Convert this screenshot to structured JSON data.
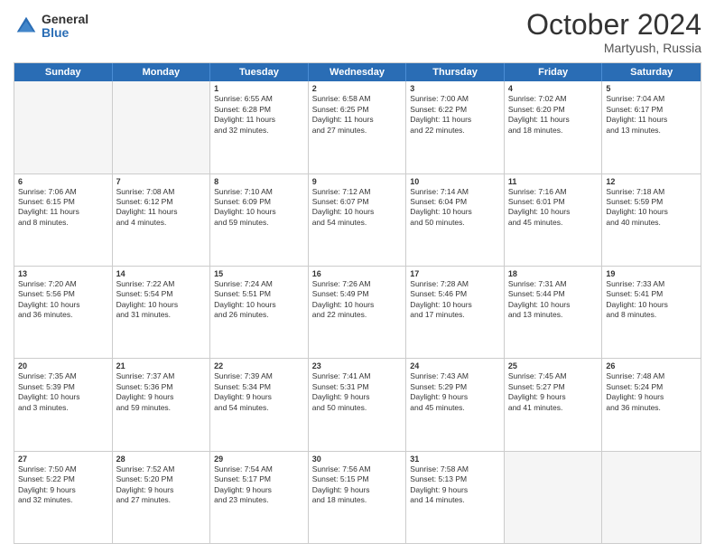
{
  "logo": {
    "general": "General",
    "blue": "Blue"
  },
  "title": "October 2024",
  "location": "Martyush, Russia",
  "header_days": [
    "Sunday",
    "Monday",
    "Tuesday",
    "Wednesday",
    "Thursday",
    "Friday",
    "Saturday"
  ],
  "weeks": [
    {
      "cells": [
        {
          "day": "",
          "lines": [],
          "empty": true
        },
        {
          "day": "",
          "lines": [],
          "empty": true
        },
        {
          "day": "1",
          "lines": [
            "Sunrise: 6:55 AM",
            "Sunset: 6:28 PM",
            "Daylight: 11 hours",
            "and 32 minutes."
          ],
          "empty": false
        },
        {
          "day": "2",
          "lines": [
            "Sunrise: 6:58 AM",
            "Sunset: 6:25 PM",
            "Daylight: 11 hours",
            "and 27 minutes."
          ],
          "empty": false
        },
        {
          "day": "3",
          "lines": [
            "Sunrise: 7:00 AM",
            "Sunset: 6:22 PM",
            "Daylight: 11 hours",
            "and 22 minutes."
          ],
          "empty": false
        },
        {
          "day": "4",
          "lines": [
            "Sunrise: 7:02 AM",
            "Sunset: 6:20 PM",
            "Daylight: 11 hours",
            "and 18 minutes."
          ],
          "empty": false
        },
        {
          "day": "5",
          "lines": [
            "Sunrise: 7:04 AM",
            "Sunset: 6:17 PM",
            "Daylight: 11 hours",
            "and 13 minutes."
          ],
          "empty": false
        }
      ]
    },
    {
      "cells": [
        {
          "day": "6",
          "lines": [
            "Sunrise: 7:06 AM",
            "Sunset: 6:15 PM",
            "Daylight: 11 hours",
            "and 8 minutes."
          ],
          "empty": false
        },
        {
          "day": "7",
          "lines": [
            "Sunrise: 7:08 AM",
            "Sunset: 6:12 PM",
            "Daylight: 11 hours",
            "and 4 minutes."
          ],
          "empty": false
        },
        {
          "day": "8",
          "lines": [
            "Sunrise: 7:10 AM",
            "Sunset: 6:09 PM",
            "Daylight: 10 hours",
            "and 59 minutes."
          ],
          "empty": false
        },
        {
          "day": "9",
          "lines": [
            "Sunrise: 7:12 AM",
            "Sunset: 6:07 PM",
            "Daylight: 10 hours",
            "and 54 minutes."
          ],
          "empty": false
        },
        {
          "day": "10",
          "lines": [
            "Sunrise: 7:14 AM",
            "Sunset: 6:04 PM",
            "Daylight: 10 hours",
            "and 50 minutes."
          ],
          "empty": false
        },
        {
          "day": "11",
          "lines": [
            "Sunrise: 7:16 AM",
            "Sunset: 6:01 PM",
            "Daylight: 10 hours",
            "and 45 minutes."
          ],
          "empty": false
        },
        {
          "day": "12",
          "lines": [
            "Sunrise: 7:18 AM",
            "Sunset: 5:59 PM",
            "Daylight: 10 hours",
            "and 40 minutes."
          ],
          "empty": false
        }
      ]
    },
    {
      "cells": [
        {
          "day": "13",
          "lines": [
            "Sunrise: 7:20 AM",
            "Sunset: 5:56 PM",
            "Daylight: 10 hours",
            "and 36 minutes."
          ],
          "empty": false
        },
        {
          "day": "14",
          "lines": [
            "Sunrise: 7:22 AM",
            "Sunset: 5:54 PM",
            "Daylight: 10 hours",
            "and 31 minutes."
          ],
          "empty": false
        },
        {
          "day": "15",
          "lines": [
            "Sunrise: 7:24 AM",
            "Sunset: 5:51 PM",
            "Daylight: 10 hours",
            "and 26 minutes."
          ],
          "empty": false
        },
        {
          "day": "16",
          "lines": [
            "Sunrise: 7:26 AM",
            "Sunset: 5:49 PM",
            "Daylight: 10 hours",
            "and 22 minutes."
          ],
          "empty": false
        },
        {
          "day": "17",
          "lines": [
            "Sunrise: 7:28 AM",
            "Sunset: 5:46 PM",
            "Daylight: 10 hours",
            "and 17 minutes."
          ],
          "empty": false
        },
        {
          "day": "18",
          "lines": [
            "Sunrise: 7:31 AM",
            "Sunset: 5:44 PM",
            "Daylight: 10 hours",
            "and 13 minutes."
          ],
          "empty": false
        },
        {
          "day": "19",
          "lines": [
            "Sunrise: 7:33 AM",
            "Sunset: 5:41 PM",
            "Daylight: 10 hours",
            "and 8 minutes."
          ],
          "empty": false
        }
      ]
    },
    {
      "cells": [
        {
          "day": "20",
          "lines": [
            "Sunrise: 7:35 AM",
            "Sunset: 5:39 PM",
            "Daylight: 10 hours",
            "and 3 minutes."
          ],
          "empty": false
        },
        {
          "day": "21",
          "lines": [
            "Sunrise: 7:37 AM",
            "Sunset: 5:36 PM",
            "Daylight: 9 hours",
            "and 59 minutes."
          ],
          "empty": false
        },
        {
          "day": "22",
          "lines": [
            "Sunrise: 7:39 AM",
            "Sunset: 5:34 PM",
            "Daylight: 9 hours",
            "and 54 minutes."
          ],
          "empty": false
        },
        {
          "day": "23",
          "lines": [
            "Sunrise: 7:41 AM",
            "Sunset: 5:31 PM",
            "Daylight: 9 hours",
            "and 50 minutes."
          ],
          "empty": false
        },
        {
          "day": "24",
          "lines": [
            "Sunrise: 7:43 AM",
            "Sunset: 5:29 PM",
            "Daylight: 9 hours",
            "and 45 minutes."
          ],
          "empty": false
        },
        {
          "day": "25",
          "lines": [
            "Sunrise: 7:45 AM",
            "Sunset: 5:27 PM",
            "Daylight: 9 hours",
            "and 41 minutes."
          ],
          "empty": false
        },
        {
          "day": "26",
          "lines": [
            "Sunrise: 7:48 AM",
            "Sunset: 5:24 PM",
            "Daylight: 9 hours",
            "and 36 minutes."
          ],
          "empty": false
        }
      ]
    },
    {
      "cells": [
        {
          "day": "27",
          "lines": [
            "Sunrise: 7:50 AM",
            "Sunset: 5:22 PM",
            "Daylight: 9 hours",
            "and 32 minutes."
          ],
          "empty": false
        },
        {
          "day": "28",
          "lines": [
            "Sunrise: 7:52 AM",
            "Sunset: 5:20 PM",
            "Daylight: 9 hours",
            "and 27 minutes."
          ],
          "empty": false
        },
        {
          "day": "29",
          "lines": [
            "Sunrise: 7:54 AM",
            "Sunset: 5:17 PM",
            "Daylight: 9 hours",
            "and 23 minutes."
          ],
          "empty": false
        },
        {
          "day": "30",
          "lines": [
            "Sunrise: 7:56 AM",
            "Sunset: 5:15 PM",
            "Daylight: 9 hours",
            "and 18 minutes."
          ],
          "empty": false
        },
        {
          "day": "31",
          "lines": [
            "Sunrise: 7:58 AM",
            "Sunset: 5:13 PM",
            "Daylight: 9 hours",
            "and 14 minutes."
          ],
          "empty": false
        },
        {
          "day": "",
          "lines": [],
          "empty": true
        },
        {
          "day": "",
          "lines": [],
          "empty": true
        }
      ]
    }
  ]
}
